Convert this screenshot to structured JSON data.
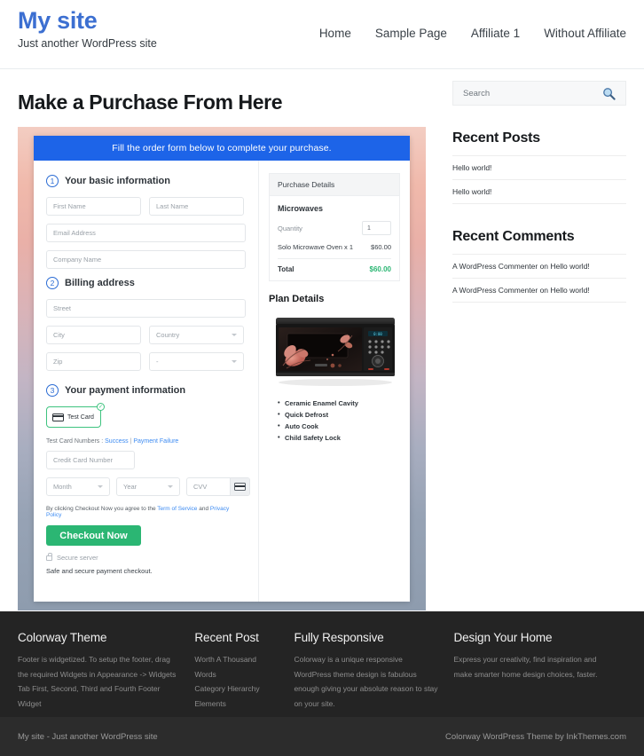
{
  "header": {
    "site_title": "My site",
    "tagline": "Just another WordPress site",
    "nav": [
      {
        "label": "Home"
      },
      {
        "label": "Sample Page"
      },
      {
        "label": "Affiliate 1"
      },
      {
        "label": "Without Affiliate"
      }
    ]
  },
  "main": {
    "page_title": "Make a Purchase From Here",
    "order_banner": "Fill the order form below to complete your purchase.",
    "steps": {
      "one": {
        "num": "1",
        "label": "Your basic information"
      },
      "two": {
        "num": "2",
        "label": "Billing address"
      },
      "three": {
        "num": "3",
        "label": "Your payment information"
      }
    },
    "fields": {
      "first_name": "First Name",
      "last_name": "Last Name",
      "email": "Email Address",
      "company": "Company Name",
      "street": "Street",
      "city": "City",
      "country": "Country",
      "zip": "Zip",
      "state": "-",
      "credit_card": "Credit Card Number",
      "month": "Month",
      "year": "Year",
      "cvv": "CVV"
    },
    "payment": {
      "tab_label": "Test Card",
      "testcard_prefix": "Test Card Numbers : ",
      "testcard_success": "Success",
      "testcard_sep": " | ",
      "testcard_failure": "Payment Failure",
      "terms_prefix": "By clicking Checkout Now you agree to the ",
      "terms_link1": "Term of Service",
      "terms_mid": " and ",
      "terms_link2": "Privacy Policy",
      "checkout_label": "Checkout Now",
      "secure_server": "Secure server",
      "safe_text": "Safe and secure payment checkout."
    },
    "summary": {
      "heading": "Purchase Details",
      "product": "Microwaves",
      "quantity_label": "Quantity",
      "quantity_value": "1",
      "line_item": "Solo Microwave Oven x 1",
      "line_price": "$60.00",
      "total_label": "Total",
      "total_price": "$60.00"
    },
    "plan": {
      "title": "Plan Details",
      "features": [
        "Ceramic Enamel Cavity",
        "Quick Defrost",
        "Auto Cook",
        "Child Safety Lock"
      ]
    }
  },
  "sidebar": {
    "search_placeholder": "Search",
    "recent_posts": {
      "title": "Recent Posts",
      "items": [
        "Hello world!",
        "Hello world!"
      ]
    },
    "recent_comments": {
      "title": "Recent Comments",
      "items": [
        "A WordPress Commenter on Hello world!",
        "A WordPress Commenter on Hello world!"
      ]
    }
  },
  "footer": {
    "columns": [
      {
        "title": "Colorway Theme",
        "paragraph": "Footer is widgetized. To setup the footer, drag the required Widgets in Appearance -> Widgets Tab First, Second, Third and Fourth Footer Widget"
      },
      {
        "title": "Recent Post",
        "items": [
          "Worth A Thousand Words",
          "Category Hierarchy",
          "Elements"
        ]
      },
      {
        "title": "Fully Responsive",
        "paragraph": "Colorway is a unique responsive WordPress theme design is fabulous enough giving your absolute reason to stay on your site."
      },
      {
        "title": "Design Your Home",
        "paragraph": "Express your creativity, find inspiration and make smarter home design choices, faster."
      }
    ],
    "bottom_left": "My site - Just another WordPress site",
    "bottom_right": "Colorway WordPress Theme by InkThemes.com"
  },
  "colors": {
    "brand_blue": "#3c6fd1",
    "banner_blue": "#1d64e8",
    "accent_green": "#2bb673",
    "link_blue": "#3d8bf2",
    "footer_dark": "#242424"
  }
}
